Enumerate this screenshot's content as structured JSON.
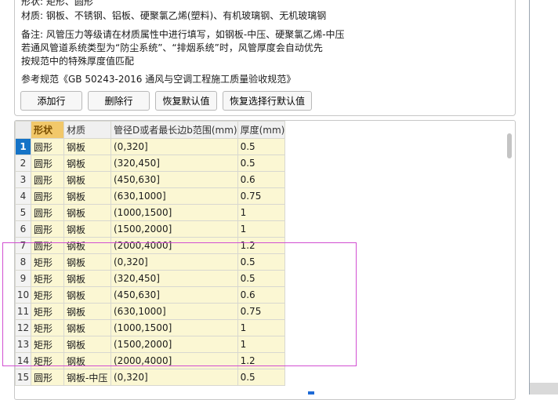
{
  "info": {
    "shape_line": "形状: 矩形、圆形",
    "material_line": "材质: 钢板、不锈钢、铝板、硬聚氯乙烯(塑料)、有机玻璃钢、无机玻璃钢",
    "note_line1": "备注: 风管压力等级请在材质属性中进行填写，如钢板-中压、硬聚氯乙烯-中压",
    "note_line2": "若通风管道系统类型为“防尘系统”、“排烟系统”时，风管厚度会自动优先",
    "note_line3": "按规范中的特殊厚度值匹配",
    "reference_line": "参考规范《GB 50243-2016 通风与空调工程施工质量验收规范》"
  },
  "toolbar": {
    "add_row": "添加行",
    "delete_row": "删除行",
    "restore_default": "恢复默认值",
    "restore_selected_default": "恢复选择行默认值"
  },
  "table": {
    "headers": {
      "shape": "形状",
      "material": "材质",
      "range": "管径D或者最长边b范围(mm)",
      "thickness": "厚度(mm)"
    },
    "rows": [
      {
        "num": "1",
        "shape": "圆形",
        "material": "钢板",
        "range": "(0,320]",
        "thickness": "0.5"
      },
      {
        "num": "2",
        "shape": "圆形",
        "material": "钢板",
        "range": "(320,450]",
        "thickness": "0.5"
      },
      {
        "num": "3",
        "shape": "圆形",
        "material": "钢板",
        "range": "(450,630]",
        "thickness": "0.6"
      },
      {
        "num": "4",
        "shape": "圆形",
        "material": "钢板",
        "range": "(630,1000]",
        "thickness": "0.75"
      },
      {
        "num": "5",
        "shape": "圆形",
        "material": "钢板",
        "range": "(1000,1500]",
        "thickness": "1"
      },
      {
        "num": "6",
        "shape": "圆形",
        "material": "钢板",
        "range": "(1500,2000]",
        "thickness": "1"
      },
      {
        "num": "7",
        "shape": "圆形",
        "material": "钢板",
        "range": "(2000,4000]",
        "thickness": "1.2"
      },
      {
        "num": "8",
        "shape": "矩形",
        "material": "钢板",
        "range": "(0,320]",
        "thickness": "0.5"
      },
      {
        "num": "9",
        "shape": "矩形",
        "material": "钢板",
        "range": "(320,450]",
        "thickness": "0.5"
      },
      {
        "num": "10",
        "shape": "矩形",
        "material": "钢板",
        "range": "(450,630]",
        "thickness": "0.6"
      },
      {
        "num": "11",
        "shape": "矩形",
        "material": "钢板",
        "range": "(630,1000]",
        "thickness": "0.75"
      },
      {
        "num": "12",
        "shape": "矩形",
        "material": "钢板",
        "range": "(1000,1500]",
        "thickness": "1"
      },
      {
        "num": "13",
        "shape": "矩形",
        "material": "钢板",
        "range": "(1500,2000]",
        "thickness": "1"
      },
      {
        "num": "14",
        "shape": "矩形",
        "material": "钢板",
        "range": "(2000,4000]",
        "thickness": "1.2"
      },
      {
        "num": "15",
        "shape": "圆形",
        "material": "钢板-中压",
        "range": "(0,320]",
        "thickness": "0.5"
      }
    ]
  }
}
